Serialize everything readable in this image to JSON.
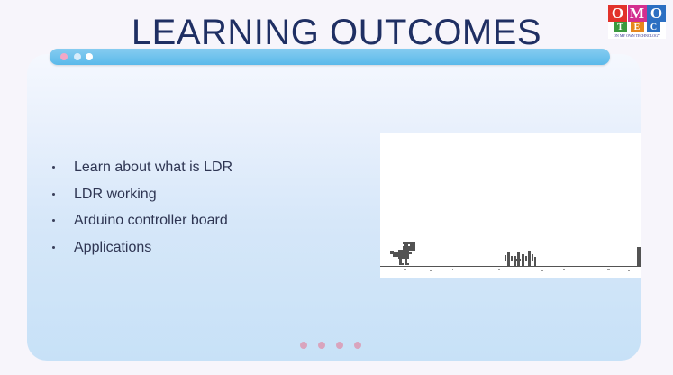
{
  "slide": {
    "title": "LEARNING OUTCOMES",
    "bullets": [
      "Learn about what is LDR",
      "LDR working",
      "Arduino controller board",
      "Applications"
    ]
  },
  "logo": {
    "top_letters": [
      "O",
      "M",
      "O"
    ],
    "bottom_letters": [
      "T",
      "E",
      "C"
    ],
    "top_colors": [
      "#e2322b",
      "#d32f8f",
      "#2c6fc2"
    ],
    "bottom_colors": [
      "#3a9a3e",
      "#e6861c",
      "#2c6fc2"
    ],
    "tagline": "ON MY OWN TECHNOLOGY"
  },
  "topbar": {
    "dot_colors": [
      "#f2a7c6",
      "#d6ecfb",
      "#ffffff"
    ]
  },
  "pager": {
    "count": 4,
    "dot_color": "#d9a4bd"
  },
  "game": {
    "icons": [
      "dino-icon",
      "cactus-icon"
    ]
  },
  "colors": {
    "title": "#1f2f63",
    "bullet_text": "#2e3552",
    "topbar": "#5ab9ea"
  }
}
